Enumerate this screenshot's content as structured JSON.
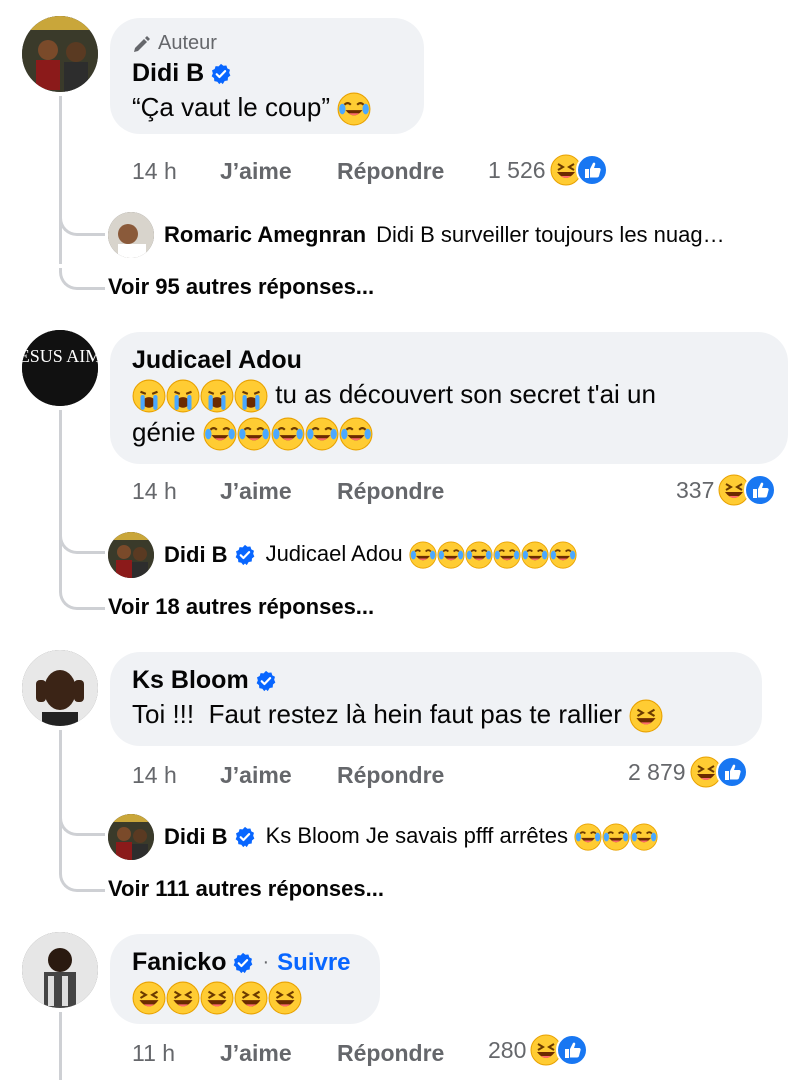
{
  "colors": {
    "bubble": "#f0f2f5",
    "verified": "#0866ff",
    "link": "#0866ff",
    "muted": "#65676b",
    "thread_line": "#ced0d4"
  },
  "comments": [
    {
      "author_badge": "Auteur",
      "name": "Didi B",
      "verified": true,
      "text": "“Ça vaut le coup”",
      "emoji": [
        "laughing-crying"
      ],
      "time": "14 h",
      "like_label": "J’aime",
      "reply_label": "Répondre",
      "reaction_count": "1 526",
      "reply_preview": {
        "name": "Romaric Amegnran",
        "verified": false,
        "text": "Didi B surveiller toujours les nuag…"
      },
      "more_replies": "Voir 95 autres réponses..."
    },
    {
      "name": "Judicael Adou",
      "verified": false,
      "avatar_text": "ESUS AIM",
      "text_line1": "tu as découvert son secret t'ai un",
      "text_line2": "génie",
      "time": "14 h",
      "like_label": "J’aime",
      "reply_label": "Répondre",
      "reaction_count": "337",
      "reply_preview": {
        "name": "Didi B",
        "verified": true,
        "text": "Judicael Adou"
      },
      "more_replies": "Voir 18 autres réponses..."
    },
    {
      "name": "Ks Bloom",
      "verified": true,
      "text": "Toi !!!  Faut restez là hein faut pas te rallier",
      "time": "14 h",
      "like_label": "J’aime",
      "reply_label": "Répondre",
      "reaction_count": "2 879",
      "reply_preview": {
        "name": "Didi B",
        "verified": true,
        "text": "Ks Bloom Je savais pfff arrêtes"
      },
      "more_replies": "Voir 111 autres réponses..."
    },
    {
      "name": "Fanicko",
      "verified": true,
      "follow_label": "Suivre",
      "time": "11 h",
      "like_label": "J’aime",
      "reply_label": "Répondre",
      "reaction_count": "280"
    }
  ],
  "icons": {
    "author": "pencil-icon",
    "verified": "verified-badge-icon",
    "reactions": [
      "haha-reaction-icon",
      "like-reaction-icon"
    ]
  }
}
